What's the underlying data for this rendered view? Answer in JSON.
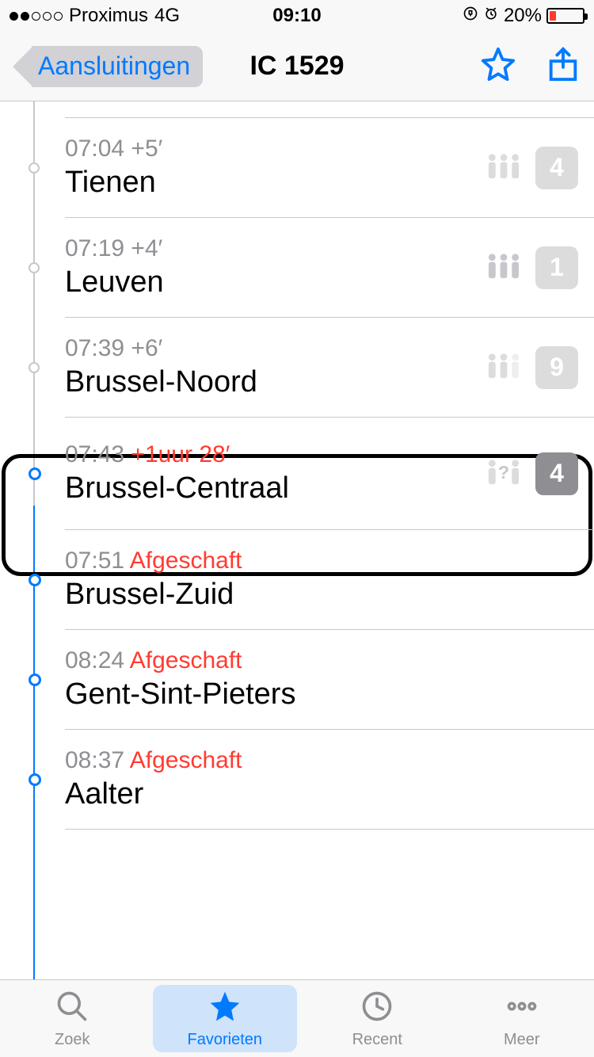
{
  "status": {
    "carrier": "Proximus",
    "network": "4G",
    "time": "09:10",
    "battery_pct": "20%"
  },
  "nav": {
    "back_label": "Aansluitingen",
    "title": "IC 1529"
  },
  "stops": [
    {
      "time": "07:04",
      "delay": "+5′",
      "delay_style": "grey",
      "name": "Tienen",
      "occupancy": "low",
      "platform": "4",
      "platform_style": "light",
      "dot": "grey",
      "border_top": true
    },
    {
      "time": "07:19",
      "delay": "+4′",
      "delay_style": "grey",
      "name": "Leuven",
      "occupancy": "high",
      "platform": "1",
      "platform_style": "light",
      "dot": "grey"
    },
    {
      "time": "07:39",
      "delay": "+6′",
      "delay_style": "grey",
      "name": "Brussel-Noord",
      "occupancy": "med",
      "platform": "9",
      "platform_style": "light",
      "dot": "grey"
    },
    {
      "time": "07:43",
      "delay": "+1uur 28′",
      "delay_style": "red",
      "name": "Brussel-Centraal",
      "occupancy": "unknown",
      "platform": "4",
      "platform_style": "dark",
      "dot": "blue",
      "highlight": true
    },
    {
      "time": "07:51",
      "delay": "Afgeschaft",
      "delay_style": "red",
      "name": "Brussel-Zuid",
      "dot": "blue"
    },
    {
      "time": "08:24",
      "delay": "Afgeschaft",
      "delay_style": "red",
      "name": "Gent-Sint-Pieters",
      "dot": "blue"
    },
    {
      "time": "08:37",
      "delay": "Afgeschaft",
      "delay_style": "red",
      "name": "Aalter",
      "dot": "blue"
    }
  ],
  "tabs": {
    "search": "Zoek",
    "favorites": "Favorieten",
    "recent": "Recent",
    "more": "Meer"
  }
}
